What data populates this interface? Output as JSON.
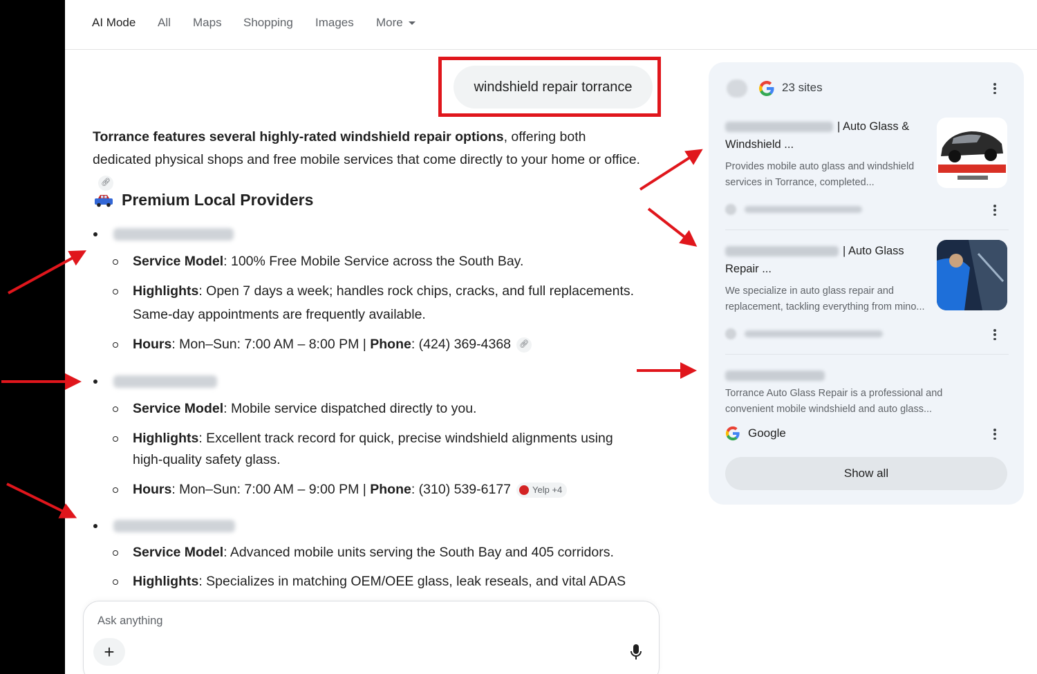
{
  "nav": {
    "items": [
      "AI Mode",
      "All",
      "Maps",
      "Shopping",
      "Images",
      "More"
    ],
    "active": "AI Mode"
  },
  "query": "windshield repair torrance",
  "answer": {
    "intro_bold": "Torrance features several highly-rated windshield repair options",
    "intro_rest": ", offering both dedicated physical shops and free mobile services that come directly to your home or office.",
    "section_title": "Premium Local Providers",
    "providers": [
      {
        "bullets": [
          {
            "label": "Service Model",
            "text": ": 100% Free Mobile Service across the South Bay."
          },
          {
            "label": "Highlights",
            "text": ": Open 7 days a week; handles rock chips, cracks, and full replacements.",
            "text2": "Same-day appointments are frequently available."
          },
          {
            "label": "Hours",
            "text": ": Mon–Sun: 7:00 AM – 8:00 PM | ",
            "label2": "Phone",
            "text3": ": (424) 369-4368"
          }
        ]
      },
      {
        "bullets": [
          {
            "label": "Service Model",
            "text": ": Mobile service dispatched directly to you."
          },
          {
            "label": "Highlights",
            "text": ": Excellent track record for quick, precise windshield alignments using",
            "text2": "high-quality safety glass."
          },
          {
            "label": "Hours",
            "text": ": Mon–Sun: 7:00 AM – 9:00 PM | ",
            "label2": "Phone",
            "text3": ": (310) 539-6177",
            "chip": "Yelp +4"
          }
        ]
      },
      {
        "bullets": [
          {
            "label": "Service Model",
            "text": ": Advanced mobile units serving the South Bay and 405 corridors."
          },
          {
            "label": "Highlights",
            "text": ": Specializes in matching OEM/OEE glass, leak reseals, and vital ADAS"
          }
        ]
      }
    ]
  },
  "ask": {
    "placeholder": "Ask anything"
  },
  "sources": {
    "count_label": "23 sites",
    "items": [
      {
        "title_visible": "| Auto Glass &",
        "title_line2": "Windshield ...",
        "desc": "Provides mobile auto glass and windshield services in Torrance, completed..."
      },
      {
        "title_visible": "| Auto Glass",
        "title_line2": "Repair ...",
        "desc": "We specialize in auto glass repair and replacement, tackling everything from mino..."
      },
      {
        "desc": "Torrance Auto Glass Repair is a professional and convenient mobile windshield and auto glass..."
      }
    ],
    "google_label": "Google",
    "show_all": "Show all"
  },
  "colors": {
    "annotation_red": "#e0161c",
    "panel_bg": "#f0f4f9"
  }
}
